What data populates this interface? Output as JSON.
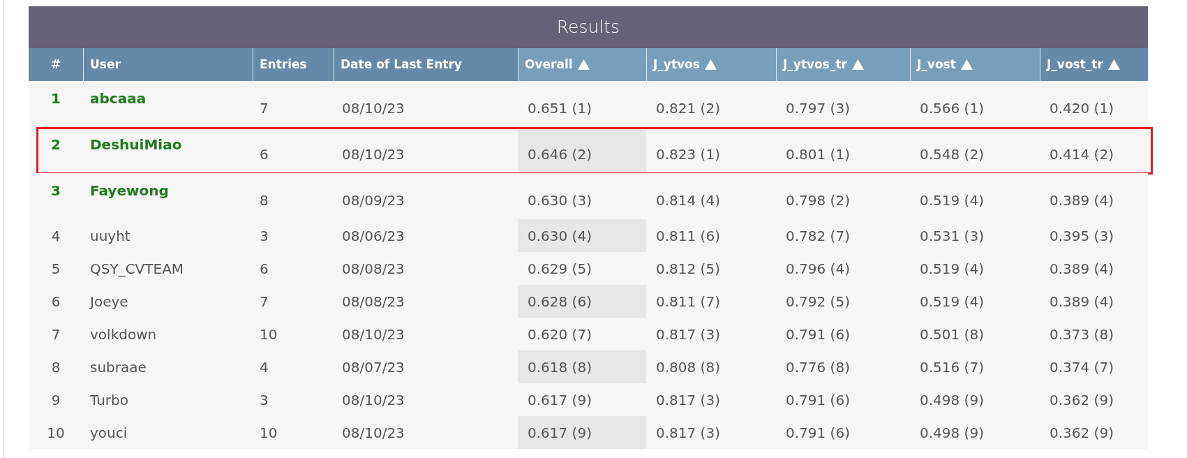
{
  "title": "Results",
  "columns": [
    {
      "label": "#",
      "sort_arrow": false,
      "highlighted": false
    },
    {
      "label": "User",
      "sort_arrow": false,
      "highlighted": false
    },
    {
      "label": "Entries",
      "sort_arrow": false,
      "highlighted": false
    },
    {
      "label": "Date of Last Entry",
      "sort_arrow": false,
      "highlighted": false
    },
    {
      "label": "Overall",
      "sort_arrow": true,
      "highlighted": true
    },
    {
      "label": "J_ytvos",
      "sort_arrow": true,
      "highlighted": true
    },
    {
      "label": "J_ytvos_tr",
      "sort_arrow": true,
      "highlighted": true
    },
    {
      "label": "J_vost",
      "sort_arrow": true,
      "highlighted": true
    },
    {
      "label": "J_vost_tr",
      "sort_arrow": true,
      "highlighted": false
    }
  ],
  "rows": [
    {
      "rank": "1",
      "user": "abcaaa",
      "top": true,
      "outlined": false,
      "entries": "7",
      "date": "08/10/23",
      "scores": [
        "0.651 (1)",
        "0.821 (2)",
        "0.797 (3)",
        "0.566 (1)",
        "0.420 (1)"
      ]
    },
    {
      "rank": "2",
      "user": "DeshuiMiao",
      "top": true,
      "outlined": true,
      "entries": "6",
      "date": "08/10/23",
      "scores": [
        "0.646 (2)",
        "0.823 (1)",
        "0.801 (1)",
        "0.548 (2)",
        "0.414 (2)"
      ]
    },
    {
      "rank": "3",
      "user": "Fayewong",
      "top": true,
      "outlined": false,
      "entries": "8",
      "date": "08/09/23",
      "scores": [
        "0.630 (3)",
        "0.814 (4)",
        "0.798 (2)",
        "0.519 (4)",
        "0.389 (4)"
      ]
    },
    {
      "rank": "4",
      "user": "uuyht",
      "top": false,
      "outlined": false,
      "entries": "3",
      "date": "08/06/23",
      "scores": [
        "0.630 (4)",
        "0.811 (6)",
        "0.782 (7)",
        "0.531 (3)",
        "0.395 (3)"
      ]
    },
    {
      "rank": "5",
      "user": "QSY_CVTEAM",
      "top": false,
      "outlined": false,
      "entries": "6",
      "date": "08/08/23",
      "scores": [
        "0.629 (5)",
        "0.812 (5)",
        "0.796 (4)",
        "0.519 (4)",
        "0.389 (4)"
      ]
    },
    {
      "rank": "6",
      "user": "Joeye",
      "top": false,
      "outlined": false,
      "entries": "7",
      "date": "08/08/23",
      "scores": [
        "0.628 (6)",
        "0.811 (7)",
        "0.792 (5)",
        "0.519 (4)",
        "0.389 (4)"
      ]
    },
    {
      "rank": "7",
      "user": "volkdown",
      "top": false,
      "outlined": false,
      "entries": "10",
      "date": "08/10/23",
      "scores": [
        "0.620 (7)",
        "0.817 (3)",
        "0.791 (6)",
        "0.501 (8)",
        "0.373 (8)"
      ]
    },
    {
      "rank": "8",
      "user": "subraae",
      "top": false,
      "outlined": false,
      "entries": "4",
      "date": "08/07/23",
      "scores": [
        "0.618 (8)",
        "0.808 (8)",
        "0.776 (8)",
        "0.516 (7)",
        "0.374 (7)"
      ]
    },
    {
      "rank": "9",
      "user": "Turbo",
      "top": false,
      "outlined": false,
      "entries": "3",
      "date": "08/10/23",
      "scores": [
        "0.617 (9)",
        "0.817 (3)",
        "0.791 (6)",
        "0.498 (9)",
        "0.362 (9)"
      ]
    },
    {
      "rank": "10",
      "user": "youci",
      "top": false,
      "outlined": false,
      "entries": "10",
      "date": "08/10/23",
      "scores": [
        "0.617 (9)",
        "0.817 (3)",
        "0.791 (6)",
        "0.498 (9)",
        "0.362 (9)"
      ]
    }
  ]
}
